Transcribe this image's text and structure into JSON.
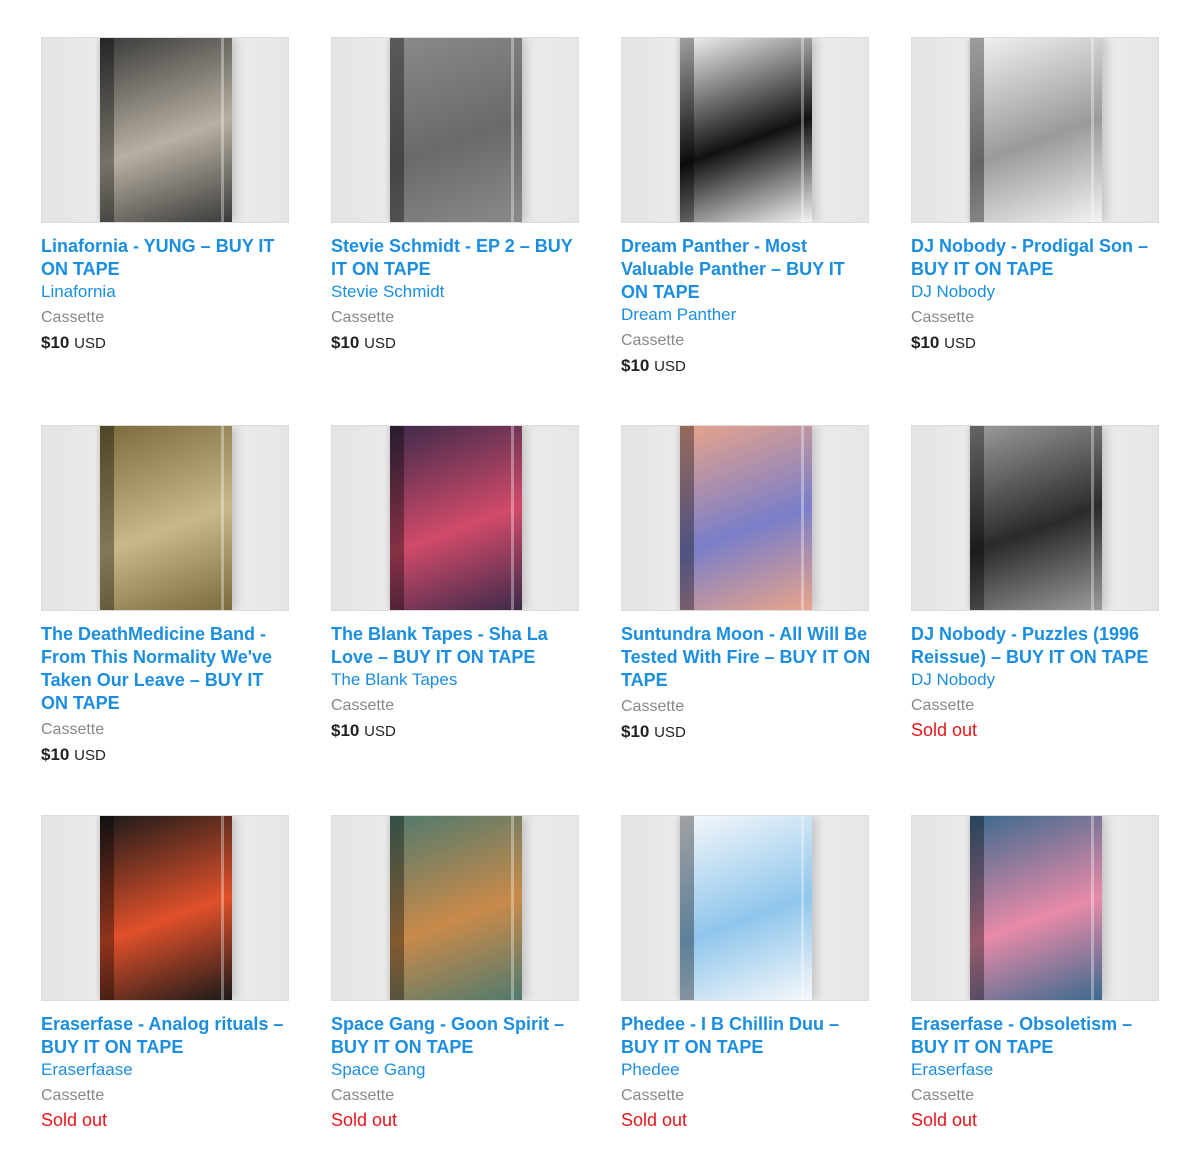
{
  "products": [
    {
      "title": "Linafornia - YUNG – BUY IT ON TAPE",
      "artist": "Linafornia",
      "format": "Cassette",
      "price": "$10",
      "currency": "USD",
      "sold_out": "",
      "tape_color": "#3a3a3a",
      "tape_accent": "#b8b0a2"
    },
    {
      "title": "Stevie Schmidt - EP 2 – BUY IT ON TAPE",
      "artist": "Stevie Schmidt",
      "format": "Cassette",
      "price": "$10",
      "currency": "USD",
      "sold_out": "",
      "tape_color": "#8a8a8a",
      "tape_accent": "#6a6a6a"
    },
    {
      "title": "Dream Panther - Most Valuable Panther – BUY IT ON TAPE",
      "artist": "Dream Panther",
      "format": "Cassette",
      "price": "$10",
      "currency": "USD",
      "sold_out": "",
      "tape_color": "#f4f4f4",
      "tape_accent": "#111111"
    },
    {
      "title": "DJ Nobody - Prodigal Son – BUY IT ON TAPE",
      "artist": "DJ Nobody",
      "format": "Cassette",
      "price": "$10",
      "currency": "USD",
      "sold_out": "",
      "tape_color": "#f2f2f2",
      "tape_accent": "#9a9a9a"
    },
    {
      "title": "The DeathMedicine Band - From This Normality We've Taken Our Leave – BUY IT ON TAPE",
      "artist": "",
      "format": "Cassette",
      "price": "$10",
      "currency": "USD",
      "sold_out": "",
      "tape_color": "#7a6a3c",
      "tape_accent": "#c9b98a"
    },
    {
      "title": "The Blank Tapes - Sha La Love – BUY IT ON TAPE",
      "artist": "The Blank Tapes",
      "format": "Cassette",
      "price": "$10",
      "currency": "USD",
      "sold_out": "",
      "tape_color": "#3d2a4a",
      "tape_accent": "#d14a6a"
    },
    {
      "title": "Suntundra Moon - All Will Be Tested With Fire – BUY IT ON TAPE",
      "artist": "",
      "format": "Cassette",
      "price": "$10",
      "currency": "USD",
      "sold_out": "",
      "tape_color": "#e9a48a",
      "tape_accent": "#7a7ec9"
    },
    {
      "title": "DJ Nobody - Puzzles (1996 Reissue) – BUY IT ON TAPE",
      "artist": "DJ Nobody",
      "format": "Cassette",
      "price": "",
      "currency": "",
      "sold_out": "Sold out",
      "tape_color": "#9c9c9c",
      "tape_accent": "#2a2a2a"
    },
    {
      "title": "Eraserfase - Analog rituals – BUY IT ON TAPE",
      "artist": "Eraserfaase",
      "format": "Cassette",
      "price": "",
      "currency": "",
      "sold_out": "Sold out",
      "tape_color": "#1a1a1a",
      "tape_accent": "#e0502a"
    },
    {
      "title": "Space Gang - Goon Spirit – BUY IT ON TAPE",
      "artist": "Space Gang",
      "format": "Cassette",
      "price": "",
      "currency": "",
      "sold_out": "Sold out",
      "tape_color": "#4f7a6e",
      "tape_accent": "#c98a4a"
    },
    {
      "title": "Phedee - I B Chillin Duu – BUY IT ON TAPE",
      "artist": "Phedee",
      "format": "Cassette",
      "price": "",
      "currency": "",
      "sold_out": "Sold out",
      "tape_color": "#f6f8fa",
      "tape_accent": "#8fc6ec"
    },
    {
      "title": "Eraserfase - Obsoletism – BUY IT ON TAPE",
      "artist": "Eraserfase",
      "format": "Cassette",
      "price": "",
      "currency": "",
      "sold_out": "Sold out",
      "tape_color": "#3a6a8e",
      "tape_accent": "#e88aa8"
    }
  ]
}
